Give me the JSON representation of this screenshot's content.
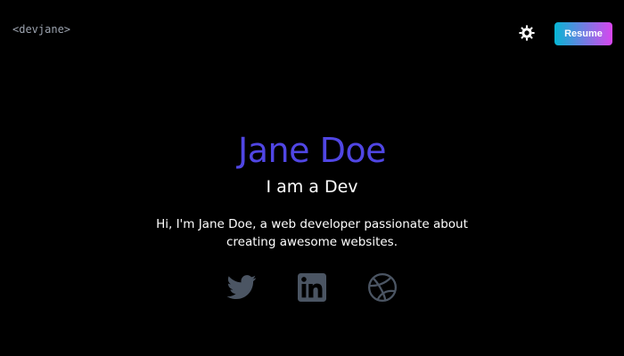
{
  "header": {
    "logo_text": "<devjane>",
    "theme_toggle_icon": "sun-icon",
    "resume_label": "Resume"
  },
  "hero": {
    "name": "Jane Doe",
    "role": "I am a Dev",
    "intro": "Hi, I'm Jane Doe, a web developer passionate about creating awesome websites."
  },
  "socials": [
    {
      "icon": "twitter-icon"
    },
    {
      "icon": "linkedin-icon"
    },
    {
      "icon": "dribbble-icon"
    }
  ],
  "colors": {
    "background": "#000000",
    "name": "#5046e4",
    "logo": "#9ca3af",
    "social_icon": "#4b5563",
    "resume_gradient_start": "#06b6d4",
    "resume_gradient_end": "#d946ef"
  }
}
